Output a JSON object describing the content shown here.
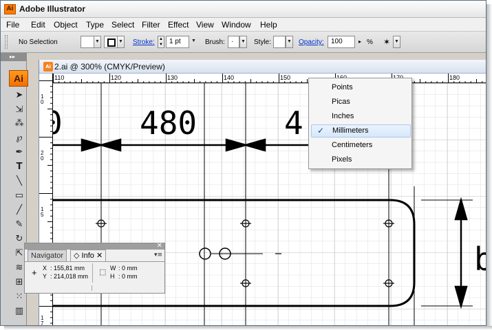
{
  "window": {
    "app_icon": "Ai",
    "title": "Adobe Illustrator"
  },
  "menus": [
    "File",
    "Edit",
    "Object",
    "Type",
    "Select",
    "Filter",
    "Effect",
    "View",
    "Window",
    "Help"
  ],
  "control_bar": {
    "selection_status": "No Selection",
    "stroke_label": "Stroke:",
    "stroke_weight": "1 pt",
    "brush_label": "Brush:",
    "brush_value": "·",
    "style_label": "Style:",
    "opacity_label": "Opacity:",
    "opacity_value": "100",
    "opacity_arrow": "▸",
    "percent": "%"
  },
  "tools_panel": {
    "badge": "Ai",
    "collapse_glyph": "▸▸"
  },
  "document": {
    "tab_icon": "Ai",
    "title": "2.ai @ 300% (CMYK/Preview)"
  },
  "ruler": {
    "h_ticks": [
      "110",
      "120",
      "130",
      "140",
      "150",
      "160",
      "170",
      "180"
    ],
    "v_labels": [
      "1\n0",
      "2\n0",
      "1\n5",
      "1\n7\n0"
    ]
  },
  "drawing": {
    "dim_left": "0",
    "dim_center": "480",
    "dim_right": "4",
    "dim_edge": "b"
  },
  "units_menu": {
    "items": [
      "Points",
      "Picas",
      "Inches",
      "Millimeters",
      "Centimeters",
      "Pixels"
    ],
    "selected": "Millimeters",
    "checkmark": "✓"
  },
  "info_panel": {
    "tabs": [
      "Navigator",
      "Info"
    ],
    "active_tab": "Info",
    "x_label": "X",
    "x_value": ": 155,81 mm",
    "y_label": "Y",
    "y_value": ": 214,018 mm",
    "w_label": "W",
    "w_value": ": 0 mm",
    "h_label": "H",
    "h_value": ": 0 mm"
  },
  "colors": {
    "accent_orange": "#f58220",
    "menu_highlight": "#d6e8fb",
    "grid": "#cfcfcf"
  }
}
